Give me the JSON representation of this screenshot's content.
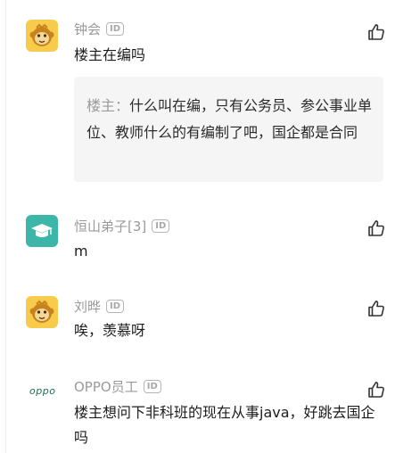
{
  "comments": [
    {
      "author": "钟会",
      "badge": "ID",
      "text": "楼主在编吗",
      "avatar_icon": "monkey-avatar-icon",
      "quote": {
        "prefix": "楼主：",
        "text": "什么叫在编，只有公务员、参公事业单位、教师什么的有编制了吧，国企都是合同"
      }
    },
    {
      "author": "恒山弟子[3]",
      "badge": "ID",
      "text": "m",
      "avatar_icon": "graduation-cap-avatar-icon"
    },
    {
      "author": "刘晔",
      "badge": "ID",
      "text": "唉，羡慕呀",
      "avatar_icon": "monkey-avatar-icon"
    },
    {
      "author": "OPPO员工",
      "badge": "ID",
      "text": "楼主想问下非科班的现在从事java，好跳去国企吗",
      "avatar_icon": "oppo-logo-icon",
      "avatar_logo_text": "oppo"
    }
  ],
  "colors": {
    "monkey_bg": "#f7cc4d",
    "cap_bg": "#3cb6a8",
    "oppo_green": "#1f6e4d"
  }
}
